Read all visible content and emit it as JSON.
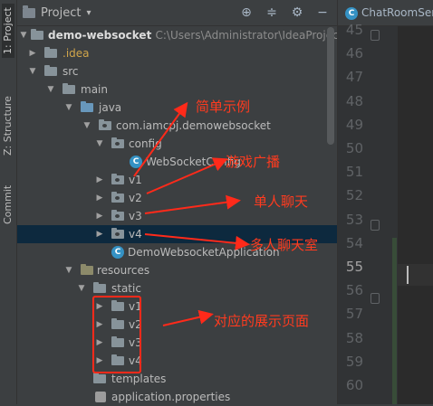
{
  "sidebar_tabs": [
    "1: Project",
    "Z: Structure",
    "Commit"
  ],
  "panel": {
    "title": "Project",
    "dropdown": "▾"
  },
  "editor_tab": {
    "title": "ChatRoomServ"
  },
  "tree": {
    "root": {
      "name": "demo-websocket",
      "path": "C:\\Users\\Administrator\\IdeaProjects"
    },
    "idea": ".idea",
    "src": "src",
    "main": "main",
    "java": "java",
    "pkg": "com.iamcpj.demowebsocket",
    "config": "config",
    "ws_config": "WebSocketConfig",
    "v1": "v1",
    "v2": "v2",
    "v3": "v3",
    "v4": "v4",
    "app": "DemoWebsocketApplication",
    "resources": "resources",
    "static": "static",
    "s_v1": "v1",
    "s_v2": "v2",
    "s_v3": "v3",
    "s_v4": "v4",
    "templates": "templates",
    "app_props": "application.properties"
  },
  "line_numbers": [
    "45",
    "46",
    "47",
    "48",
    "49",
    "50",
    "51",
    "52",
    "53",
    "54",
    "55",
    "56",
    "57",
    "58",
    "59",
    "60"
  ],
  "annotations": {
    "simple": "简单示例",
    "game": "游戏广播",
    "single": "单人聊天",
    "multi": "多人聊天室",
    "pages": "对应的展示页面"
  },
  "colors": {
    "annotation": "#ff2a1a",
    "selection": "#0d293e",
    "background": "#3c3f41",
    "editor": "#2b2b2b"
  }
}
